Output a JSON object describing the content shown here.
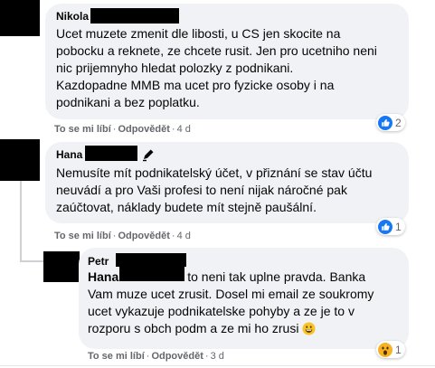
{
  "comments": [
    {
      "author": "Nikola",
      "lines": [
        "Ucet muzete zmenit dle libosti, u CS jen skocite na",
        "pobocku a reknete, ze chcete rusit. Jen pro ucetniho neni",
        "nic prijemnyho hledat polozky z podnikani.",
        "Kazdopadne MMB ma ucet pro fyzicke osoby i na",
        "podnikani a bez poplatku."
      ],
      "actions": {
        "like": "To se mi líbí",
        "reply": "Odpovědět",
        "time": "4 d"
      },
      "reaction": {
        "icon": "like-icon",
        "count": "2"
      }
    },
    {
      "author": "Hana",
      "lines": [
        "Nemusíte mít podnikatelský účet, v přiznání se stav účtu",
        "neuvádí a pro Vaši profesi to není nijak náročné pak",
        "zaúčtovat, náklady budete mít stejně paušální."
      ],
      "actions": {
        "like": "To se mi líbí",
        "reply": "Odpovědět",
        "time": "4 d"
      },
      "reaction": {
        "icon": "like-icon",
        "count": "1"
      }
    },
    {
      "author": "Petr",
      "mention": "Hana",
      "first_line_rest": "to neni tak uplne pravda. Banka",
      "lines": [
        "Vam muze ucet zrusit. Dosel mi email ze soukromy",
        "ucet vykazuje podnikatelske pohyby a ze je to v",
        "rozporu s obch podm a ze mi ho zrusi"
      ],
      "actions": {
        "like": "To se mi líbí",
        "reply": "Odpovědět",
        "time": "3 d"
      },
      "reaction": {
        "icon": "wow-icon",
        "count": "1"
      }
    }
  ],
  "colors": {
    "bubble": "#f0f2f5",
    "like_blue": "#1877f2",
    "wow_yellow": "#f7b125",
    "secondary_text": "#65676b"
  }
}
